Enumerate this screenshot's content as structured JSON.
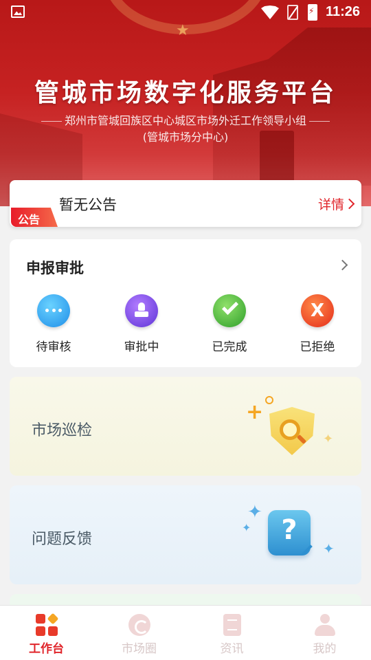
{
  "status_bar": {
    "time": "11:26"
  },
  "banner": {
    "title": "管城市场数字化服务平台",
    "subtitle": "郑州市管城回族区中心城区市场外迁工作领导小组",
    "subtitle2": "(管城市场分中心)"
  },
  "notice": {
    "badge": "公告",
    "text": "暂无公告",
    "detail": "详情"
  },
  "approval": {
    "title": "申报审批",
    "items": [
      {
        "label": "待审核",
        "icon": "pending-icon"
      },
      {
        "label": "审批中",
        "icon": "stamp-icon"
      },
      {
        "label": "已完成",
        "icon": "check-icon"
      },
      {
        "label": "已拒绝",
        "icon": "x-icon"
      }
    ],
    "reject_mark": "X"
  },
  "features": {
    "patrol": "市场巡检",
    "feedback": "问题反馈",
    "feedback_glyph": "?"
  },
  "nav": {
    "tabs": [
      {
        "label": "工作台",
        "active": true
      },
      {
        "label": "市场圈",
        "active": false
      },
      {
        "label": "资讯",
        "active": false
      },
      {
        "label": "我的",
        "active": false
      }
    ]
  },
  "colors": {
    "brand": "#e0242a",
    "banner": "#c62222"
  }
}
